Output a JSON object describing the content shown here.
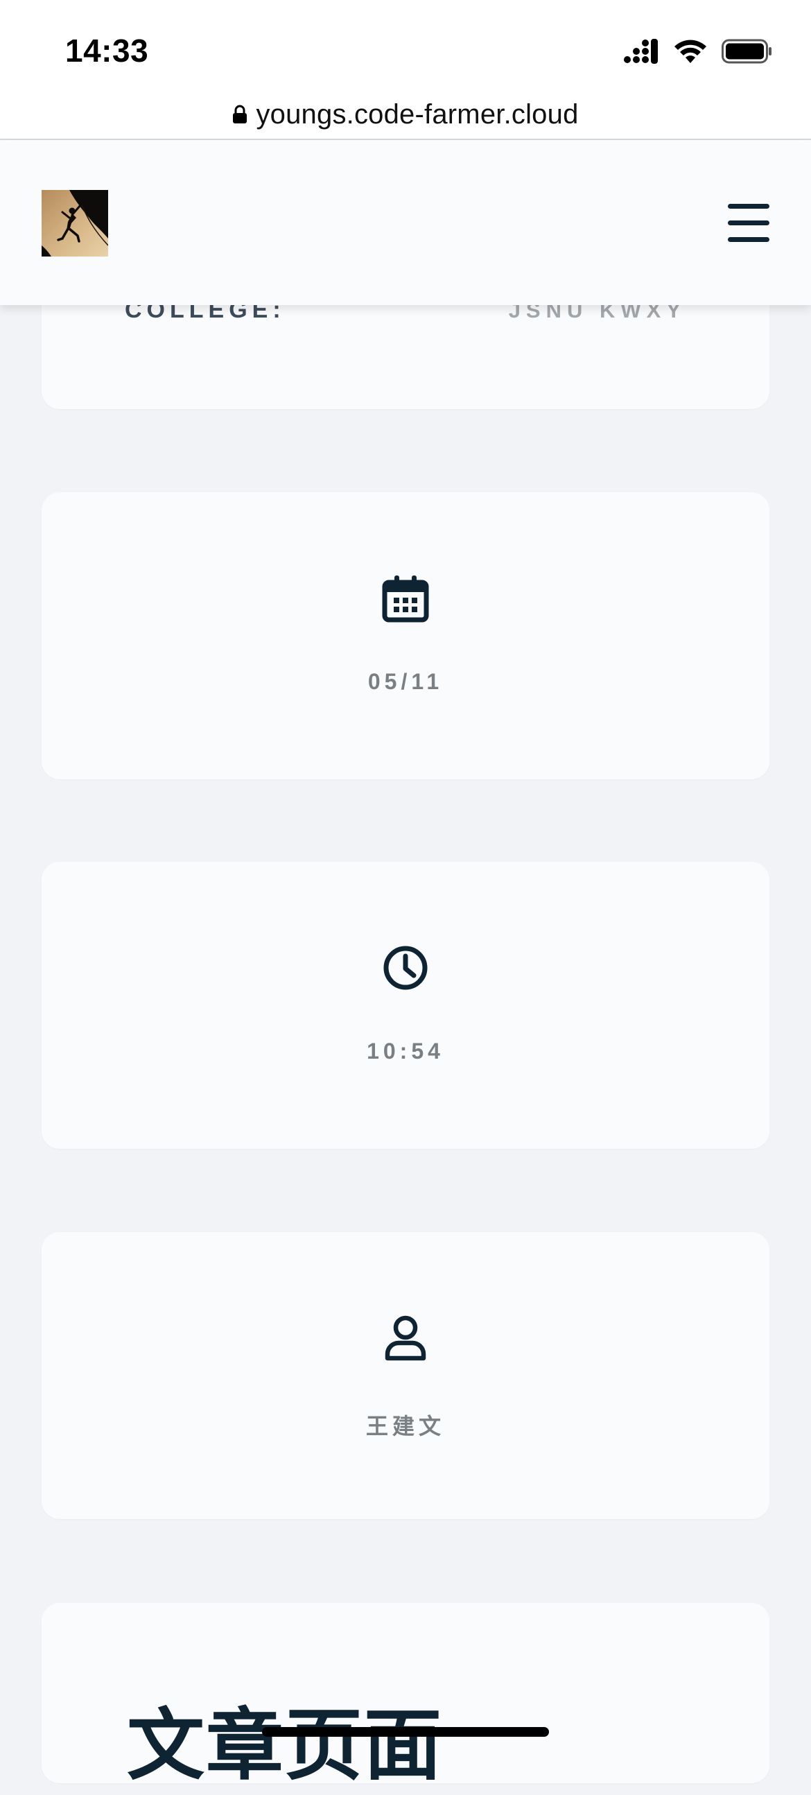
{
  "status_bar": {
    "time": "14:33"
  },
  "browser": {
    "url": "youngs.code-farmer.cloud"
  },
  "header": {
    "logo_icon": "climber-silhouette-icon",
    "menu_icon": "hamburger-menu-icon"
  },
  "profile": {
    "college_label": "COLLEGE:",
    "college_value": "JSNU KWXY"
  },
  "stats": {
    "date": {
      "icon": "calendar-icon",
      "value": "05/11"
    },
    "time": {
      "icon": "clock-icon",
      "value": "10:54"
    },
    "author": {
      "icon": "user-icon",
      "value": "王建文"
    }
  },
  "article": {
    "title": "文章页面"
  },
  "colors": {
    "primary": "#0f2433",
    "muted_text": "#7a7f84",
    "card_bg": "#fafbfc",
    "page_bg": "#f2f3f6"
  }
}
